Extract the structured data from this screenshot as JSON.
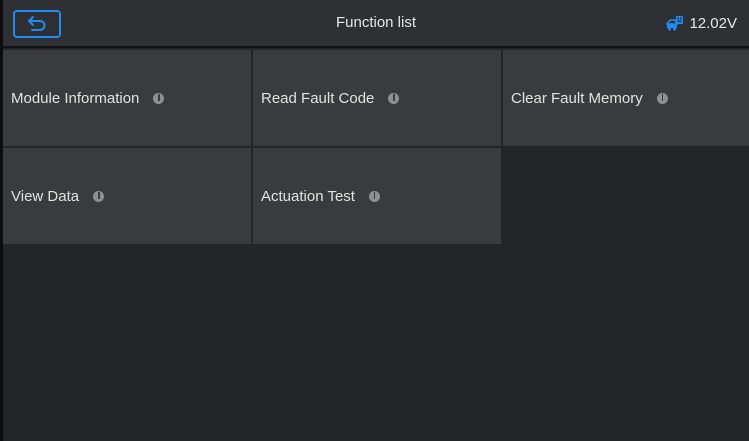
{
  "header": {
    "title": "Function list",
    "voltage": "12.02V",
    "back_icon": "back-arrow-icon",
    "battery_icon": "car-battery-icon",
    "accent_color": "#1e8cf0"
  },
  "functions": [
    {
      "label": "Module Information",
      "icon": "info-icon"
    },
    {
      "label": "Read Fault Code",
      "icon": "info-icon"
    },
    {
      "label": "Clear Fault Memory",
      "icon": "info-icon"
    },
    {
      "label": "View Data",
      "icon": "info-icon"
    },
    {
      "label": "Actuation Test",
      "icon": "info-icon"
    }
  ]
}
